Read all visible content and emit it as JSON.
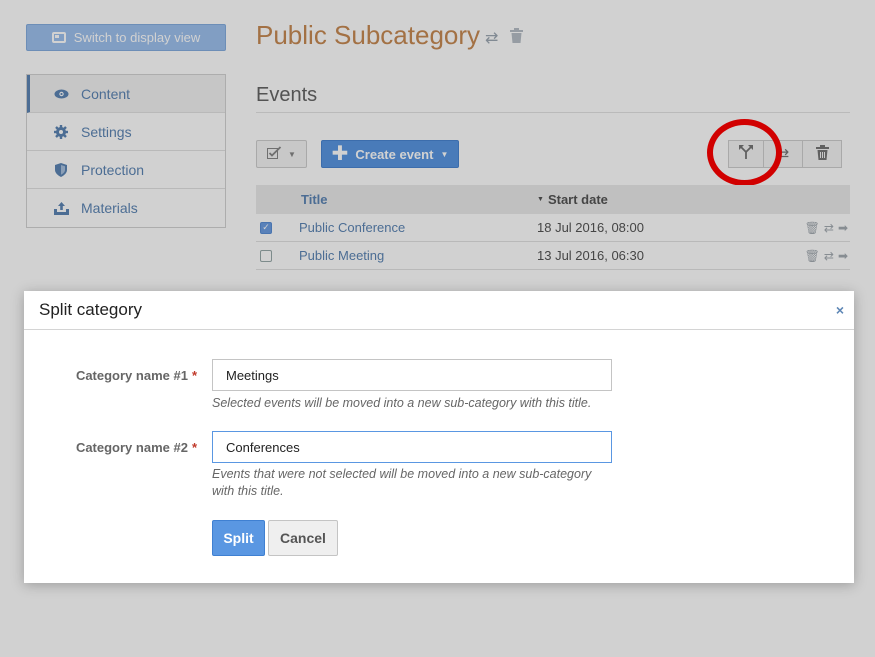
{
  "header": {
    "switch_button": "Switch to display view",
    "page_title": "Public Subcategory",
    "section_title": "Events"
  },
  "sidebar": {
    "items": [
      {
        "label": "Content",
        "icon": "eye-icon",
        "active": true
      },
      {
        "label": "Settings",
        "icon": "gear-icon",
        "active": false
      },
      {
        "label": "Protection",
        "icon": "shield-icon",
        "active": false
      },
      {
        "label": "Materials",
        "icon": "upload-icon",
        "active": false
      }
    ]
  },
  "toolbar": {
    "create_label": "Create event"
  },
  "table": {
    "columns": [
      "Title",
      "Start date"
    ],
    "rows": [
      {
        "title": "Public Conference",
        "start": "18 Jul 2016, 08:00",
        "checked": true
      },
      {
        "title": "Public Meeting",
        "start": "13 Jul 2016, 06:30",
        "checked": false
      }
    ]
  },
  "dialog": {
    "title": "Split category",
    "close": "×",
    "field1": {
      "label": "Category name #1",
      "value": "Meetings",
      "help": "Selected events will be moved into a new sub-category with this title."
    },
    "field2": {
      "label": "Category name #2",
      "value": "Conferences",
      "help": "Events that were not selected will be moved into a new sub-category with this title."
    },
    "required_mark": "*",
    "split_label": "Split",
    "cancel_label": "Cancel"
  },
  "colors": {
    "accent": "#5a97e2",
    "title": "#c78a54",
    "link": "#5d86b5",
    "highlight": "#ff0000"
  }
}
